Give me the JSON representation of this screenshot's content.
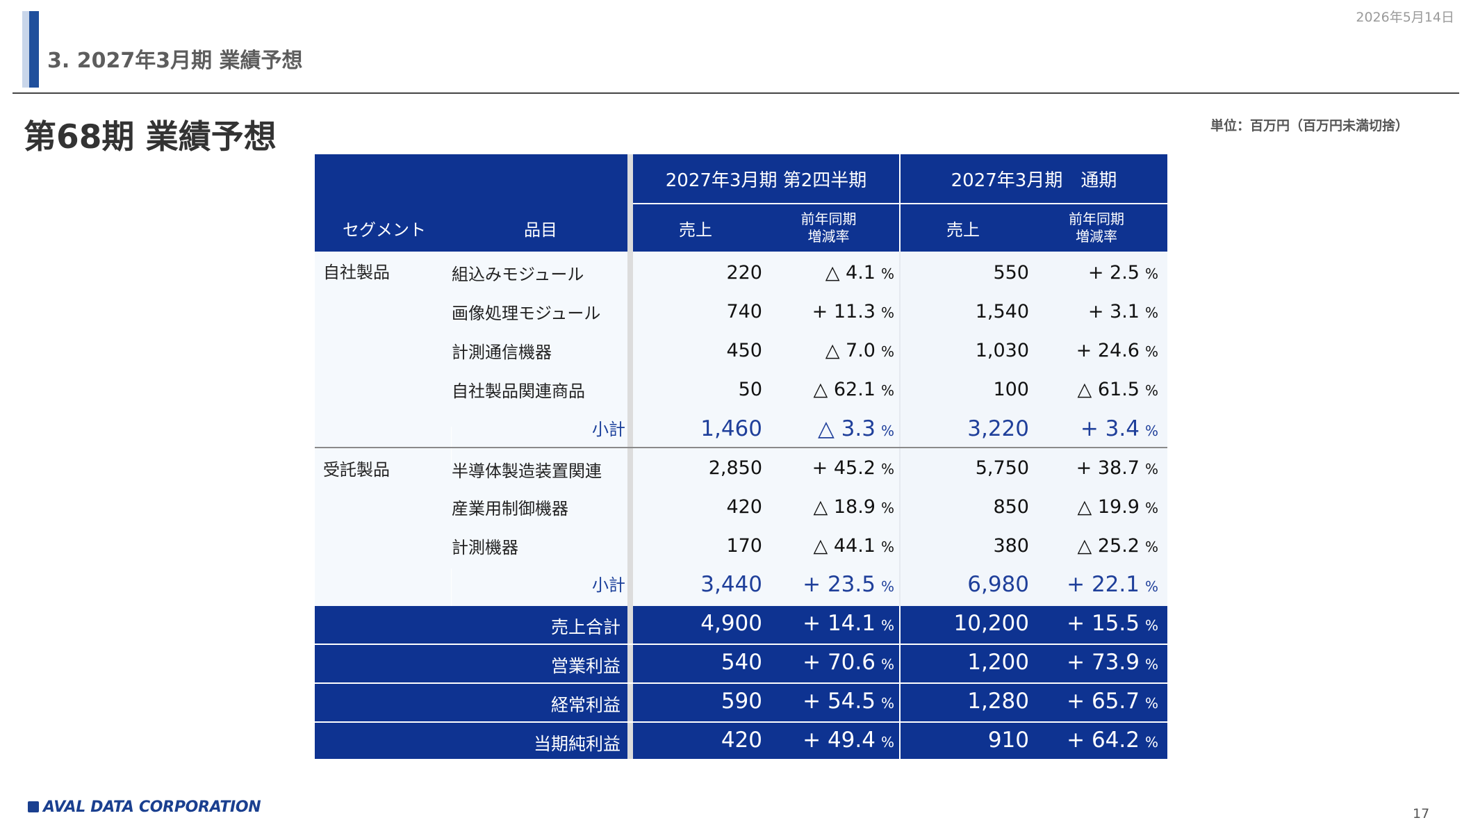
{
  "date": "2026年5月14日",
  "section_title": "3. 2027年3月期 業績予想",
  "main_title": "第68期 業績予想",
  "unit": "単位：百万円（百万円未満切捨）",
  "logo_text": "AVAL DATA CORPORATION",
  "page_number": "17",
  "table": {
    "col_headers": {
      "segment": "セグメント",
      "item": "品目",
      "period_q2": "2027年3月期 第2四半期",
      "period_full": "2027年3月期　通期",
      "sales": "売上",
      "yoy": "前年同期",
      "yoy2": "増減率"
    },
    "pct_unit": "%",
    "segment1": {
      "name": "自社製品",
      "rows": [
        {
          "item": "組込みモジュール",
          "q2_sales": "220",
          "q2_yoy": "△ 4.1",
          "fy_sales": "550",
          "fy_yoy": "+ 2.5"
        },
        {
          "item": "画像処理モジュール",
          "q2_sales": "740",
          "q2_yoy": "+ 11.3",
          "fy_sales": "1,540",
          "fy_yoy": "+ 3.1"
        },
        {
          "item": "計測通信機器",
          "q2_sales": "450",
          "q2_yoy": "△ 7.0",
          "fy_sales": "1,030",
          "fy_yoy": "+ 24.6"
        },
        {
          "item": "自社製品関連商品",
          "q2_sales": "50",
          "q2_yoy": "△ 62.1",
          "fy_sales": "100",
          "fy_yoy": "△ 61.5"
        }
      ],
      "subtotal": {
        "label": "小計",
        "q2_sales": "1,460",
        "q2_yoy": "△ 3.3",
        "fy_sales": "3,220",
        "fy_yoy": "+ 3.4"
      }
    },
    "segment2": {
      "name": "受託製品",
      "rows": [
        {
          "item": "半導体製造装置関連",
          "q2_sales": "2,850",
          "q2_yoy": "+ 45.2",
          "fy_sales": "5,750",
          "fy_yoy": "+ 38.7"
        },
        {
          "item": "産業用制御機器",
          "q2_sales": "420",
          "q2_yoy": "△ 18.9",
          "fy_sales": "850",
          "fy_yoy": "△ 19.9"
        },
        {
          "item": "計測機器",
          "q2_sales": "170",
          "q2_yoy": "△ 44.1",
          "fy_sales": "380",
          "fy_yoy": "△ 25.2"
        }
      ],
      "subtotal": {
        "label": "小計",
        "q2_sales": "3,440",
        "q2_yoy": "+ 23.5",
        "fy_sales": "6,980",
        "fy_yoy": "+ 22.1"
      }
    },
    "totals": [
      {
        "label": "売上合計",
        "q2_sales": "4,900",
        "q2_yoy": "+ 14.1",
        "fy_sales": "10,200",
        "fy_yoy": "+ 15.5"
      },
      {
        "label": "営業利益",
        "q2_sales": "540",
        "q2_yoy": "+ 70.6",
        "fy_sales": "1,200",
        "fy_yoy": "+ 73.9"
      },
      {
        "label": "経常利益",
        "q2_sales": "590",
        "q2_yoy": "+ 54.5",
        "fy_sales": "1,280",
        "fy_yoy": "+ 65.7"
      },
      {
        "label": "当期純利益",
        "q2_sales": "420",
        "q2_yoy": "+ 49.4",
        "fy_sales": "910",
        "fy_yoy": "+ 64.2"
      }
    ]
  },
  "colors": {
    "header_blue": "#0e3391",
    "subtotal_text": "#1f3f9a"
  }
}
